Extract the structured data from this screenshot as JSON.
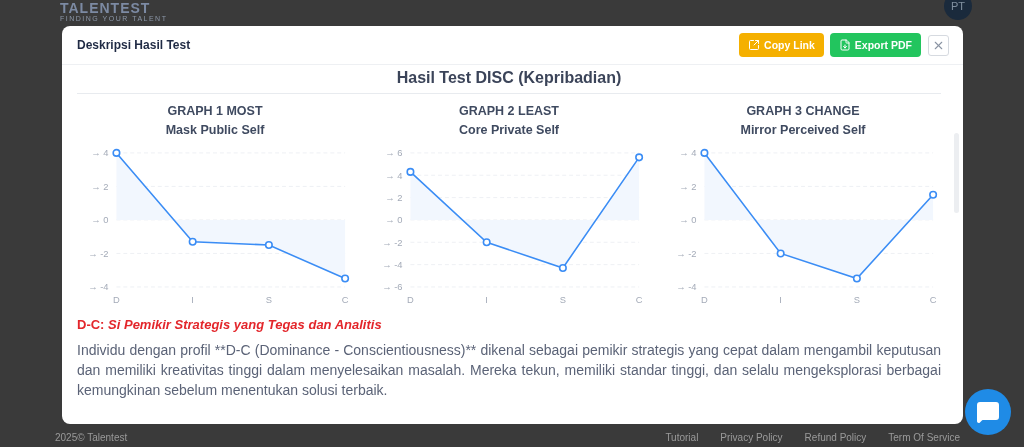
{
  "page": {
    "logo": {
      "name": "TALENTEST",
      "tagline": "FINDING YOUR TALENT"
    },
    "avatar": "PT",
    "footer": {
      "copyright": "2025© Talentest",
      "links": [
        "Tutorial",
        "Privacy Policy",
        "Refund Policy",
        "Term Of Service"
      ]
    }
  },
  "modal": {
    "title": "Deskripsi Hasil Test",
    "buttons": [
      {
        "label": "Copy Link",
        "kind": "copy"
      },
      {
        "label": "Export PDF",
        "kind": "export"
      }
    ],
    "heading": "Hasil Test DISC (Kepribadian)",
    "graphs": [
      {
        "title": "GRAPH 1 MOST",
        "subtitle": "Mask Public Self",
        "chart_data": {
          "type": "line",
          "categories": [
            "D",
            "I",
            "S",
            "C"
          ],
          "grid": true,
          "series": [
            {
              "color": "#3b8df5",
              "marker": "circle",
              "values": [
                4,
                -1.3,
                -1.5,
                -3.5
              ]
            }
          ],
          "ylim": [
            -4,
            4
          ],
          "yticks": [
            {
              "value": 4,
              "label": "→ 4"
            },
            {
              "value": 2,
              "label": "→ 2"
            },
            {
              "value": 0,
              "label": "→ 0"
            },
            {
              "value": -2,
              "label": "→ -2"
            },
            {
              "value": -4,
              "label": "→ -4"
            }
          ]
        }
      },
      {
        "title": "GRAPH 2 LEAST",
        "subtitle": "Core Private Self",
        "chart_data": {
          "type": "line",
          "categories": [
            "D",
            "I",
            "S",
            "C"
          ],
          "grid": true,
          "series": [
            {
              "color": "#3b8df5",
              "marker": "circle",
              "values": [
                4.3,
                -2,
                -4.3,
                5.6
              ]
            }
          ],
          "ylim": [
            -6,
            6
          ],
          "yticks": [
            {
              "value": 6,
              "label": "→ 6"
            },
            {
              "value": 4,
              "label": "→ 4"
            },
            {
              "value": 2,
              "label": "→ 2"
            },
            {
              "value": 0,
              "label": "→ 0"
            },
            {
              "value": -2,
              "label": "→ -2"
            },
            {
              "value": -4,
              "label": "→ -4"
            },
            {
              "value": -6,
              "label": "→ -6"
            }
          ]
        }
      },
      {
        "title": "GRAPH 3 CHANGE",
        "subtitle": "Mirror Perceived Self",
        "chart_data": {
          "type": "line",
          "categories": [
            "D",
            "I",
            "S",
            "C"
          ],
          "grid": true,
          "series": [
            {
              "color": "#3b8df5",
              "marker": "circle",
              "values": [
                4,
                -2,
                -3.5,
                1.5
              ]
            }
          ],
          "ylim": [
            -4,
            4
          ],
          "yticks": [
            {
              "value": 4,
              "label": "→ 4"
            },
            {
              "value": 2,
              "label": "→ 2"
            },
            {
              "value": 0,
              "label": "→ 0"
            },
            {
              "value": -2,
              "label": "→ -2"
            },
            {
              "value": -4,
              "label": "→ -4"
            }
          ]
        }
      }
    ],
    "profile": {
      "code": "D-C:",
      "name": "Si Pemikir Strategis yang Tegas dan Analitis",
      "description": "Individu dengan profil **D-C (Dominance - Conscientiousness)** dikenal sebagai pemikir strategis yang cepat dalam mengambil keputusan dan memiliki kreativitas tinggi dalam menyelesaikan masalah. Mereka tekun, memiliki standar tinggi, dan selalu mengeksplorasi berbagai kemungkinan sebelum menentukan solusi terbaik."
    }
  }
}
